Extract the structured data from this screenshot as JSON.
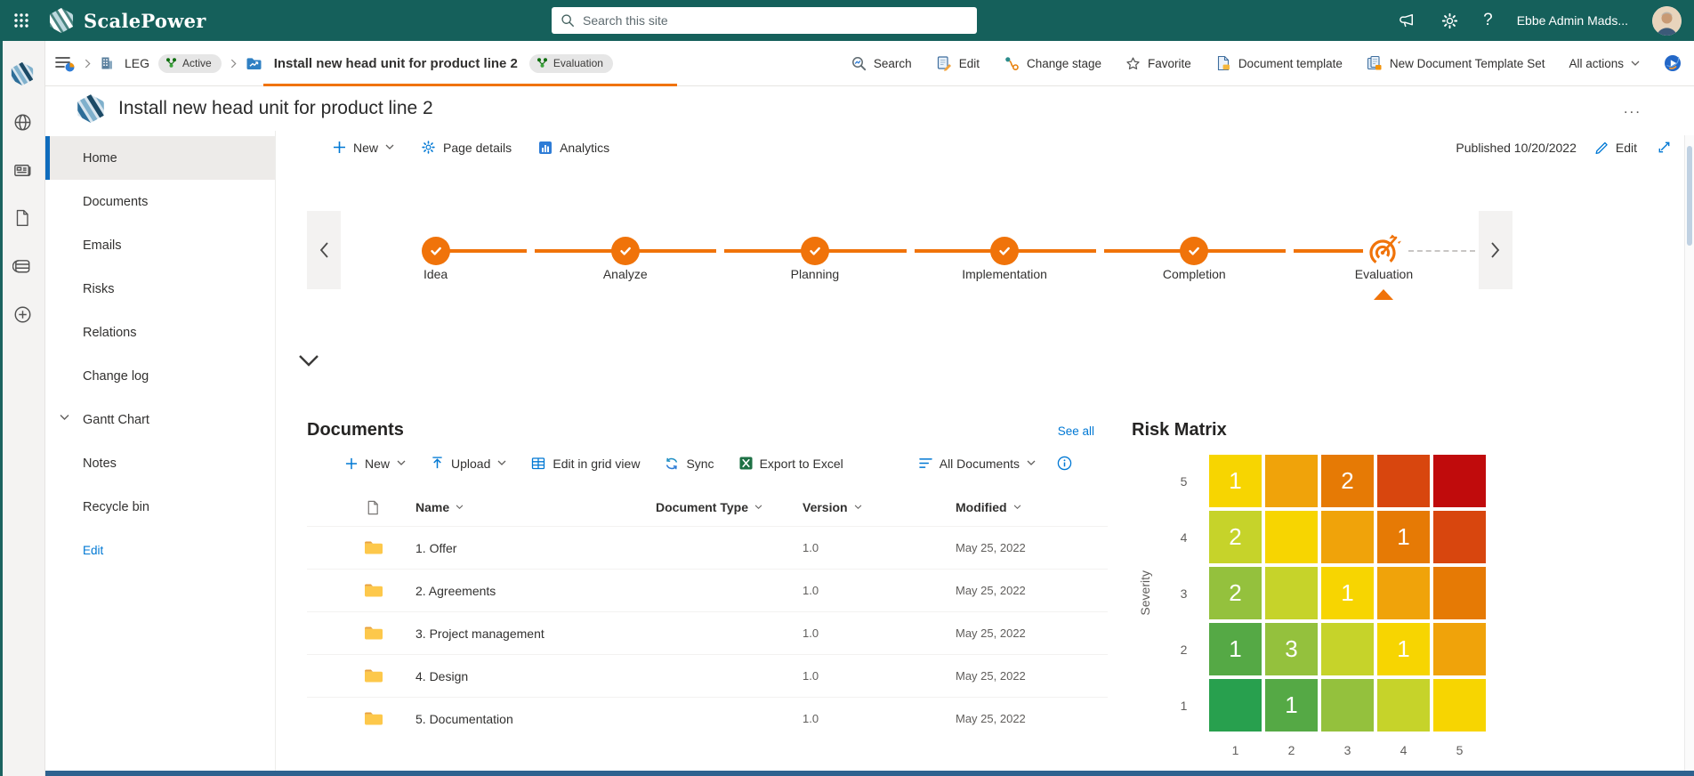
{
  "topbar": {
    "app_name": "ScalePower",
    "search_placeholder": "Search this site",
    "user_name": "Ebbe Admin Mads..."
  },
  "command_bar": {
    "breadcrumb": {
      "site": "LEG",
      "site_status": "Active",
      "page": "Install new head unit for product line 2",
      "page_stage": "Evaluation"
    },
    "actions": [
      {
        "label": "Search"
      },
      {
        "label": "Edit"
      },
      {
        "label": "Change stage"
      },
      {
        "label": "Favorite"
      },
      {
        "label": "Document template"
      },
      {
        "label": "New Document Template Set"
      }
    ],
    "all_actions_label": "All actions"
  },
  "page_header": {
    "title": "Install new head unit for product line 2",
    "more_label": "..."
  },
  "sidebar": {
    "items": [
      {
        "label": "Home",
        "cls": "selected"
      },
      {
        "label": "Documents",
        "cls": ""
      },
      {
        "label": "Emails",
        "cls": ""
      },
      {
        "label": "Risks",
        "cls": ""
      },
      {
        "label": "Relations",
        "cls": ""
      },
      {
        "label": "Change log",
        "cls": ""
      },
      {
        "label": "Gantt Chart",
        "cls": "has-chevron"
      },
      {
        "label": "Notes",
        "cls": ""
      },
      {
        "label": "Recycle bin",
        "cls": ""
      },
      {
        "label": "Edit",
        "cls": "link"
      }
    ]
  },
  "content_toolbar": {
    "new_label": "New",
    "page_details_label": "Page details",
    "analytics_label": "Analytics",
    "published_label": "Published 10/20/2022",
    "edit_label": "Edit"
  },
  "timeline": {
    "stages": [
      {
        "label": "Idea",
        "state": "done"
      },
      {
        "label": "Analyze",
        "state": "done"
      },
      {
        "label": "Planning",
        "state": "done"
      },
      {
        "label": "Implementation",
        "state": "done"
      },
      {
        "label": "Completion",
        "state": "done"
      },
      {
        "label": "Evaluation",
        "state": "current"
      }
    ]
  },
  "documents": {
    "title": "Documents",
    "see_all_label": "See all",
    "toolbar": {
      "new_label": "New",
      "upload_label": "Upload",
      "grid_label": "Edit in grid view",
      "sync_label": "Sync",
      "export_label": "Export to Excel",
      "view_label": "All Documents"
    },
    "columns": [
      "Name",
      "Document Type",
      "Version",
      "Modified"
    ],
    "rows": [
      {
        "name": "1. Offer",
        "type": "",
        "version": "1.0",
        "modified": "May 25, 2022"
      },
      {
        "name": "2. Agreements",
        "type": "",
        "version": "1.0",
        "modified": "May 25, 2022"
      },
      {
        "name": "3. Project management",
        "type": "",
        "version": "1.0",
        "modified": "May 25, 2022"
      },
      {
        "name": "4. Design",
        "type": "",
        "version": "1.0",
        "modified": "May 25, 2022"
      },
      {
        "name": "5. Documentation",
        "type": "",
        "version": "1.0",
        "modified": "May 25, 2022"
      }
    ]
  },
  "risk_matrix": {
    "title": "Risk Matrix",
    "y_axis_label": "Severity",
    "row_labels": [
      {
        "t": "5"
      },
      {
        "t": "4"
      },
      {
        "t": "3"
      },
      {
        "t": "2"
      },
      {
        "t": "1"
      }
    ],
    "col_labels": [
      {
        "t": "1"
      },
      {
        "t": "2"
      },
      {
        "t": "3"
      },
      {
        "t": "4"
      },
      {
        "t": "5"
      }
    ],
    "cells": [
      {
        "bg": "#f7d501",
        "n": "1"
      },
      {
        "bg": "#f0a30a",
        "n": ""
      },
      {
        "bg": "#e67a05",
        "n": "2"
      },
      {
        "bg": "#d8460e",
        "n": ""
      },
      {
        "bg": "#c00b0c",
        "n": ""
      },
      {
        "bg": "#c6d32a",
        "n": "2"
      },
      {
        "bg": "#f7d501",
        "n": ""
      },
      {
        "bg": "#f0a30a",
        "n": ""
      },
      {
        "bg": "#e67a05",
        "n": "1"
      },
      {
        "bg": "#d8460e",
        "n": ""
      },
      {
        "bg": "#94c13d",
        "n": "2"
      },
      {
        "bg": "#c6d32a",
        "n": ""
      },
      {
        "bg": "#f7d501",
        "n": "1"
      },
      {
        "bg": "#f0a30a",
        "n": ""
      },
      {
        "bg": "#e67a05",
        "n": ""
      },
      {
        "bg": "#55a945",
        "n": "1"
      },
      {
        "bg": "#94c13d",
        "n": "3"
      },
      {
        "bg": "#c6d32a",
        "n": ""
      },
      {
        "bg": "#f7d501",
        "n": "1"
      },
      {
        "bg": "#f0a30a",
        "n": ""
      },
      {
        "bg": "#28a04e",
        "n": ""
      },
      {
        "bg": "#55a945",
        "n": "1"
      },
      {
        "bg": "#94c13d",
        "n": ""
      },
      {
        "bg": "#c6d32a",
        "n": ""
      },
      {
        "bg": "#f7d501",
        "n": ""
      }
    ]
  },
  "chart_data": {
    "type": "heatmap",
    "title": "Risk Matrix",
    "xlabel": "",
    "ylabel": "Severity",
    "x": [
      1,
      2,
      3,
      4,
      5
    ],
    "y": [
      5,
      4,
      3,
      2,
      1
    ],
    "values": [
      [
        1,
        null,
        2,
        null,
        null
      ],
      [
        2,
        null,
        null,
        1,
        null
      ],
      [
        2,
        null,
        1,
        null,
        null
      ],
      [
        1,
        3,
        null,
        1,
        null
      ],
      [
        null,
        1,
        null,
        null,
        null
      ]
    ],
    "legend_position": "none",
    "grid": false
  },
  "colors": {
    "topbar_teal": "#15605b",
    "accent_orange": "#f0730a",
    "link_blue": "#0078d4",
    "selected_nav_bar": "#0f6cbd"
  }
}
